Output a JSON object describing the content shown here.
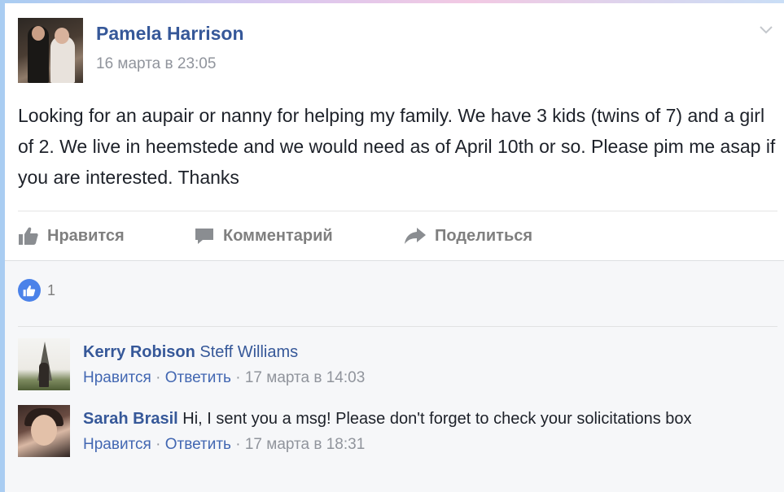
{
  "post": {
    "author": "Pamela Harrison",
    "timestamp": "16 марта в 23:05",
    "text": "Looking for an aupair or nanny for helping my family. We have 3 kids (twins of 7) and a girl of 2. We live in heemstede and we would need as of April 10th or so. Please pim me asap if you are interested. Thanks"
  },
  "actions": {
    "like": "Нравится",
    "comment": "Комментарий",
    "share": "Поделиться"
  },
  "reactions": {
    "count": "1",
    "icon": "like-icon"
  },
  "comments": [
    {
      "author": "Kerry Robison",
      "tagged": "Steff Williams",
      "text": "",
      "like": "Нравится",
      "separator": " · ",
      "reply": "Ответить",
      "timestamp": "17 марта в 14:03"
    },
    {
      "author": "Sarah Brasil",
      "tagged": "",
      "text": "Hi, I sent you a msg! Please don't forget to check your solicitations box",
      "like": "Нравится",
      "separator": " · ",
      "reply": "Ответить",
      "timestamp": "17 марта в 18:31"
    }
  ],
  "colors": {
    "link": "#365899",
    "meta": "#90949c",
    "like_badge": "#4b82e9"
  }
}
